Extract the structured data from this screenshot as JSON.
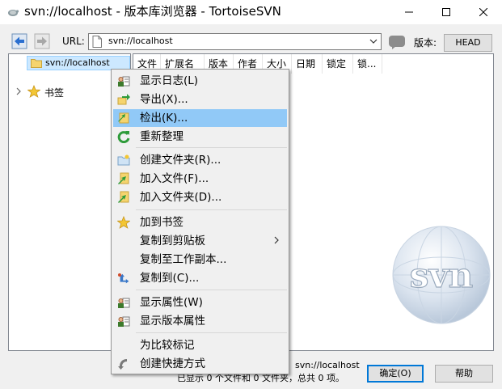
{
  "window": {
    "title": "svn://localhost - 版本库浏览器 - TortoiseSVN"
  },
  "toolbar": {
    "url_label": "URL:",
    "url_value": "svn://localhost",
    "revision_label": "版本:",
    "revision_button": "HEAD"
  },
  "tree": {
    "root": "svn://localhost",
    "bookmarks": "书签"
  },
  "columns": [
    "文件",
    "扩展名",
    "版本",
    "作者",
    "大小",
    "日期",
    "锁定",
    "锁..."
  ],
  "context_menu": {
    "items": [
      {
        "label": "显示日志(L)",
        "icon": "log-icon"
      },
      {
        "label": "导出(X)...",
        "icon": "export-icon"
      },
      {
        "label": "检出(K)...",
        "icon": "checkout-icon",
        "highlighted": true
      },
      {
        "label": "重新整理",
        "icon": "refresh-icon"
      },
      {
        "label": "创建文件夹(R)...",
        "icon": "new-folder-icon"
      },
      {
        "label": "加入文件(F)...",
        "icon": "add-file-icon"
      },
      {
        "label": "加入文件夹(D)...",
        "icon": "add-folder-icon"
      },
      {
        "label": "加到书签",
        "icon": "star-icon"
      },
      {
        "label": "复制到剪贴板",
        "submenu": true
      },
      {
        "label": "复制至工作副本..."
      },
      {
        "label": "复制到(C)...",
        "icon": "copy-to-icon"
      },
      {
        "label": "显示属性(W)",
        "icon": "properties-icon"
      },
      {
        "label": "显示版本属性",
        "icon": "revprops-icon"
      },
      {
        "label": "为比较标记"
      },
      {
        "label": "创建快捷方式",
        "icon": "shortcut-icon"
      }
    ]
  },
  "status": {
    "path": "svn://localhost",
    "summary": "已显示 0 个文件和 0 文件夹，总共 0 项。"
  },
  "buttons": {
    "ok": "确定(O)",
    "help": "帮助"
  },
  "logo": {
    "text": "svn"
  },
  "colors": {
    "highlight": "#91c9f7",
    "tree_selection": "#cce8ff",
    "accent": "#0078d7"
  }
}
